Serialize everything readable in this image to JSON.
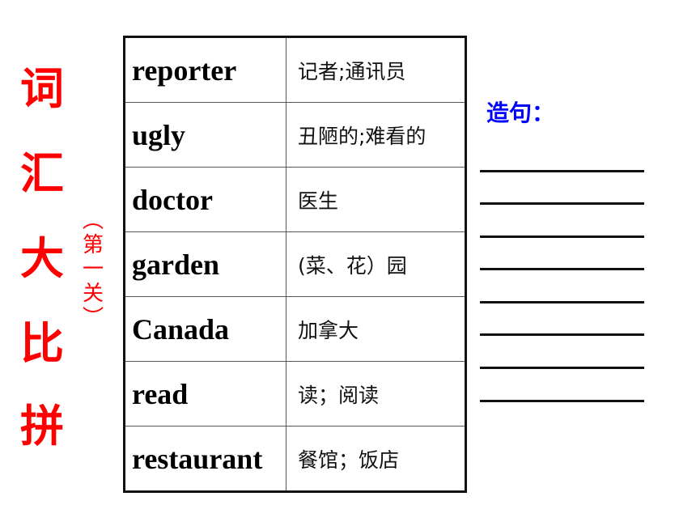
{
  "title": {
    "chars": [
      "词",
      "汇",
      "大",
      "比",
      "拼"
    ],
    "color": "#ff0000"
  },
  "subtitle": {
    "open": "︵",
    "chars": [
      "第",
      "一",
      "关"
    ],
    "close": "︶"
  },
  "vocabulary": [
    {
      "word": "reporter",
      "meaning": "记者;通讯员"
    },
    {
      "word": "ugly",
      "meaning": "丑陋的;难看的"
    },
    {
      "word": "doctor",
      "meaning": "医生"
    },
    {
      "word": "garden",
      "meaning": "(菜、花）园"
    },
    {
      "word": "Canada",
      "meaning": "加拿大"
    },
    {
      "word": "read",
      "meaning": "读；阅读"
    },
    {
      "word": "restaurant",
      "meaning": "餐馆；饭店"
    }
  ],
  "sentence_section": {
    "label": "造句：",
    "color": "#0000ff",
    "blank_line_count": 8
  }
}
